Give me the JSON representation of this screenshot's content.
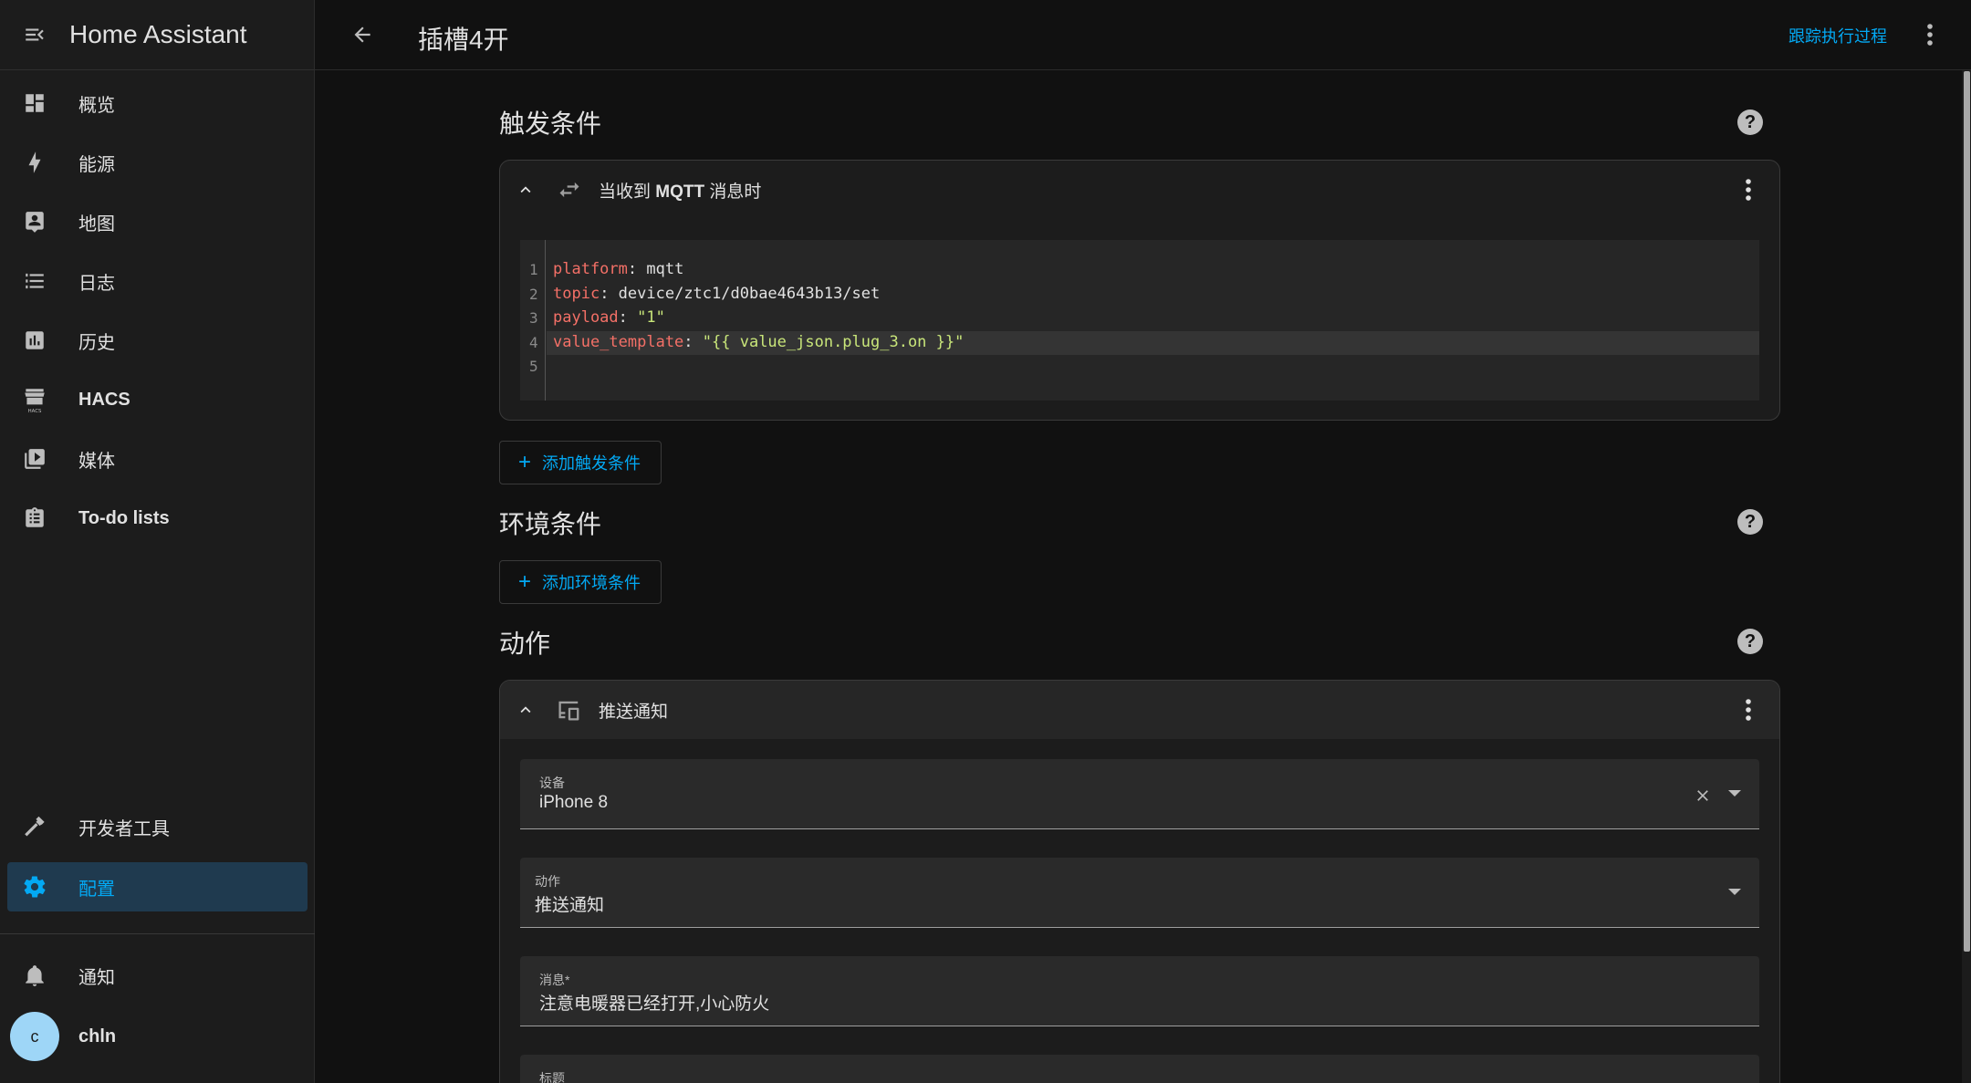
{
  "app": {
    "title": "Home Assistant"
  },
  "sidebar": {
    "items": [
      {
        "label": "概览",
        "icon": "dashboard-icon"
      },
      {
        "label": "能源",
        "icon": "lightning-icon"
      },
      {
        "label": "地图",
        "icon": "map-account-icon"
      },
      {
        "label": "日志",
        "icon": "list-icon"
      },
      {
        "label": "历史",
        "icon": "chart-box-icon"
      },
      {
        "label": "HACS",
        "icon": "hacs-store-icon"
      },
      {
        "label": "媒体",
        "icon": "play-box-icon"
      },
      {
        "label": "To-do lists",
        "icon": "clipboard-list-icon"
      }
    ],
    "bottom": [
      {
        "label": "开发者工具",
        "icon": "hammer-icon"
      },
      {
        "label": "配置",
        "icon": "gear-icon",
        "active": true
      }
    ],
    "notifications": {
      "label": "通知",
      "icon": "bell-icon"
    },
    "user": {
      "initial": "c",
      "name": "chln"
    }
  },
  "header": {
    "title": "插槽4开",
    "trace_link": "跟踪执行过程"
  },
  "triggers": {
    "heading": "触发条件",
    "card_title_prefix": "当收到",
    "card_title_bold": "MQTT",
    "card_title_suffix": "消息时",
    "code_lines": [
      {
        "n": "1",
        "key": "platform",
        "value": "mqtt",
        "type": "plain"
      },
      {
        "n": "2",
        "key": "topic",
        "value": "device/ztc1/d0bae4643b13/set",
        "type": "plain"
      },
      {
        "n": "3",
        "key": "payload",
        "value": "\"1\"",
        "type": "string"
      },
      {
        "n": "4",
        "key": "value_template",
        "value": "\"{{ value_json.plug_3.on }}\"",
        "type": "string"
      },
      {
        "n": "5",
        "key": "",
        "value": "",
        "type": "plain"
      }
    ],
    "add_label": "添加触发条件"
  },
  "conditions": {
    "heading": "环境条件",
    "add_label": "添加环境条件"
  },
  "actions": {
    "heading": "动作",
    "card_title": "推送通知",
    "fields": [
      {
        "label": "设备",
        "value": "iPhone 8",
        "clearable": true
      },
      {
        "label": "动作",
        "value": "推送通知",
        "clearable": false
      },
      {
        "label": "消息*",
        "value": "注意电暖器已经打开,小心防火",
        "clearable": false
      },
      {
        "label": "标题",
        "value": "",
        "clearable": false
      }
    ]
  },
  "colors": {
    "accent": "#03a9f4",
    "background": "#111111",
    "sidebar": "#1c1c1c"
  }
}
